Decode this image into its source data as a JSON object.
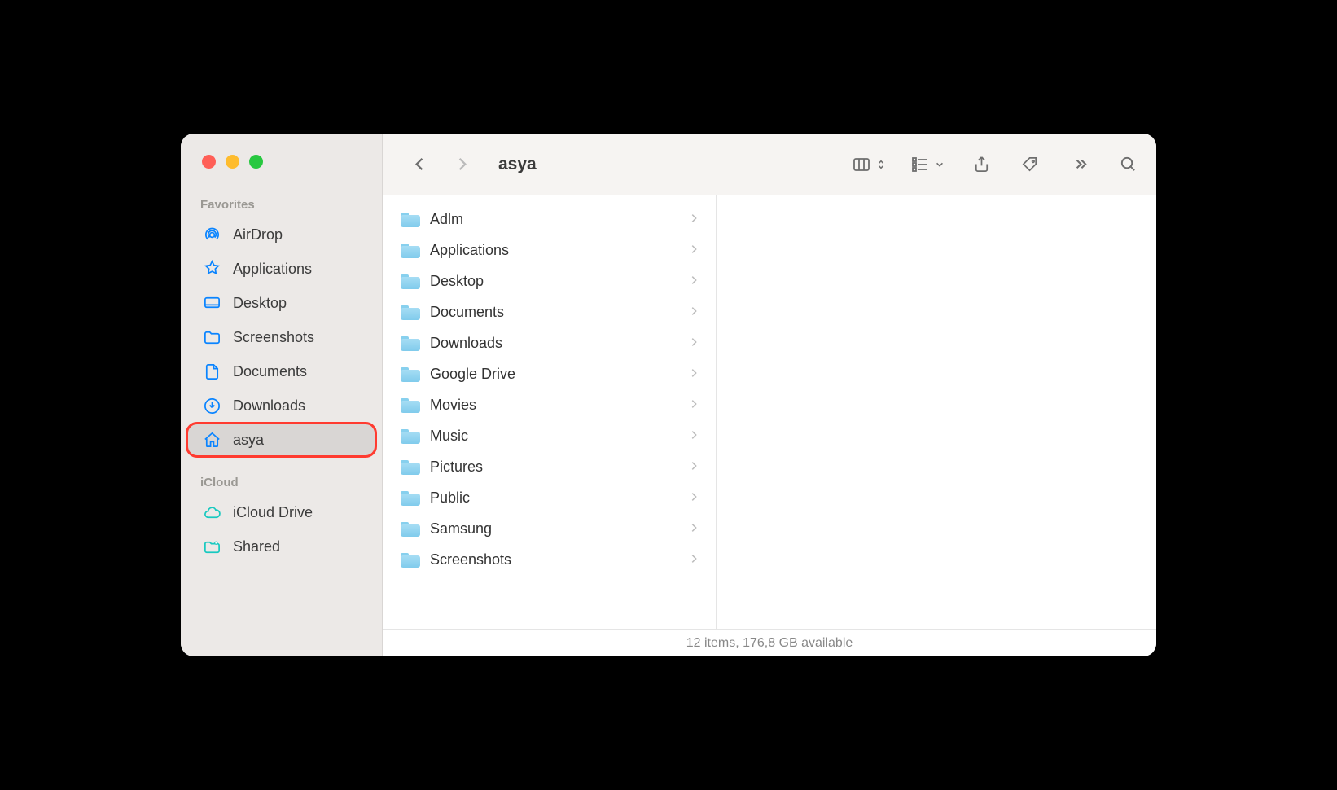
{
  "window": {
    "title": "asya"
  },
  "sidebar": {
    "sections": [
      {
        "header": "Favorites",
        "items": [
          {
            "id": "airdrop",
            "label": "AirDrop",
            "icon": "airdrop",
            "active": false
          },
          {
            "id": "applications",
            "label": "Applications",
            "icon": "apps",
            "active": false
          },
          {
            "id": "desktop",
            "label": "Desktop",
            "icon": "desktop",
            "active": false
          },
          {
            "id": "screenshots",
            "label": "Screenshots",
            "icon": "folder",
            "active": false
          },
          {
            "id": "documents",
            "label": "Documents",
            "icon": "doc",
            "active": false
          },
          {
            "id": "downloads",
            "label": "Downloads",
            "icon": "downloads",
            "active": false
          },
          {
            "id": "asya",
            "label": "asya",
            "icon": "home",
            "active": true,
            "highlight": true
          }
        ]
      },
      {
        "header": "iCloud",
        "items": [
          {
            "id": "icloud-drive",
            "label": "iCloud Drive",
            "icon": "cloud",
            "active": false
          },
          {
            "id": "shared",
            "label": "Shared",
            "icon": "shared",
            "active": false
          }
        ]
      }
    ]
  },
  "content": {
    "columns": [
      {
        "items": [
          {
            "name": "Adlm"
          },
          {
            "name": "Applications"
          },
          {
            "name": "Desktop"
          },
          {
            "name": "Documents"
          },
          {
            "name": "Downloads"
          },
          {
            "name": "Google Drive"
          },
          {
            "name": "Movies"
          },
          {
            "name": "Music"
          },
          {
            "name": "Pictures"
          },
          {
            "name": "Public"
          },
          {
            "name": "Samsung"
          },
          {
            "name": "Screenshots"
          }
        ]
      },
      {
        "items": []
      }
    ]
  },
  "status": {
    "text": "12 items, 176,8 GB available"
  }
}
